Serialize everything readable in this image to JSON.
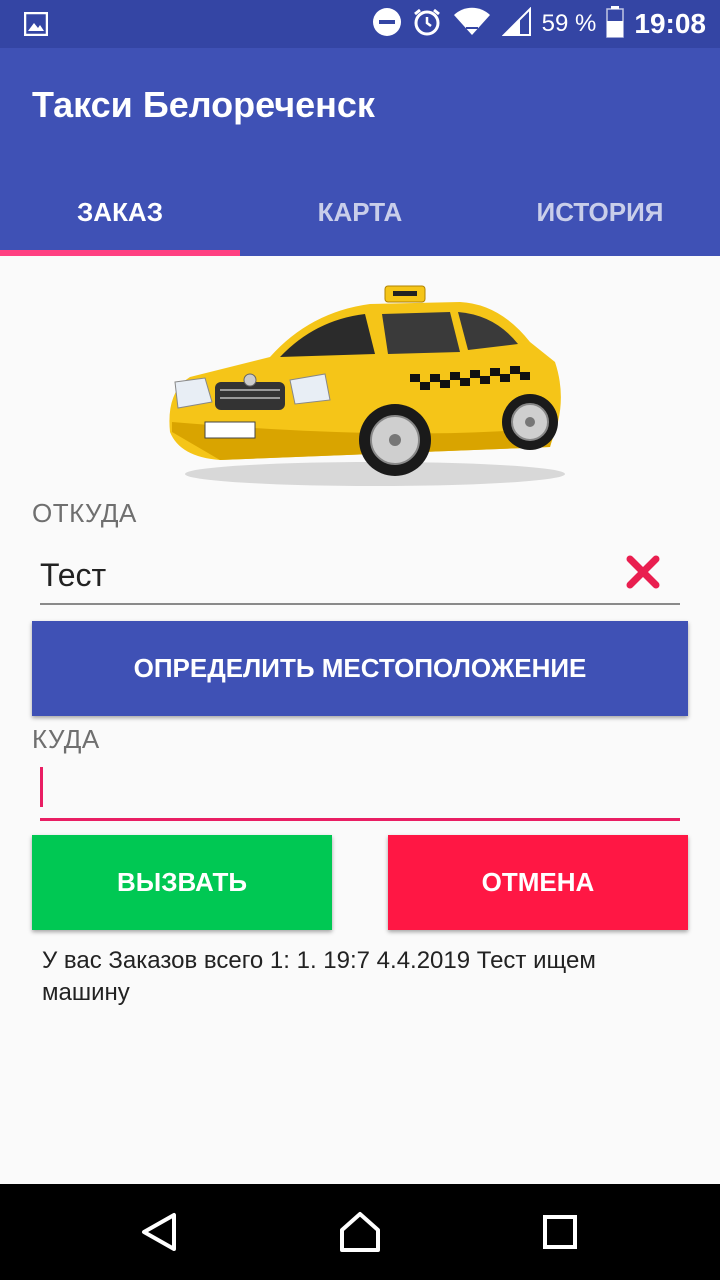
{
  "status_bar": {
    "battery_percent_label": "59 %",
    "time": "19:08",
    "icons": [
      "image-notification-icon",
      "do-not-disturb-icon",
      "alarm-icon",
      "wifi-icon",
      "signal-icon",
      "battery-icon"
    ]
  },
  "app": {
    "title": "Такси Белореченск"
  },
  "tabs": [
    {
      "label": "ЗАКАЗ",
      "active": true
    },
    {
      "label": "КАРТА",
      "active": false
    },
    {
      "label": "ИСТОРИЯ",
      "active": false
    }
  ],
  "from": {
    "label": "ОТКУДА",
    "value": "Тест",
    "clear_icon": "close-icon"
  },
  "locate_button": "ОПРЕДЕЛИТЬ МЕСТОПОЛОЖЕНИЕ",
  "to": {
    "label": "КУДА",
    "value": ""
  },
  "call_button": "ВЫЗВАТЬ",
  "cancel_button": "ОТМЕНА",
  "orders_text": "У вас Заказов всего 1:  1. 19:7 4.4.2019 Тест  ищем машину",
  "colors": {
    "primary": "#3f51b5",
    "primary_dark": "#3445a4",
    "accent": "#ff4081",
    "call": "#00c853",
    "cancel": "#ff1744"
  }
}
